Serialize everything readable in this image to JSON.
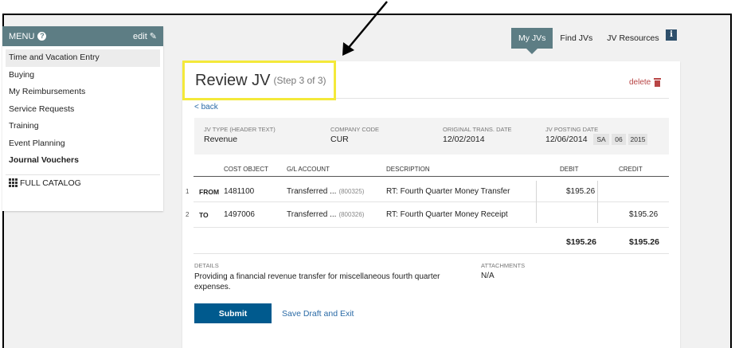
{
  "sidebar": {
    "title": "MENU",
    "edit_label": "edit",
    "items": [
      {
        "label": "Time and Vacation Entry"
      },
      {
        "label": "Buying"
      },
      {
        "label": "My Reimbursements"
      },
      {
        "label": "Service Requests"
      },
      {
        "label": "Training"
      },
      {
        "label": "Event Planning"
      },
      {
        "label": "Journal Vouchers"
      }
    ],
    "catalog_label": "FULL CATALOG"
  },
  "tabs": [
    {
      "label": "My JVs",
      "active": true
    },
    {
      "label": "Find JVs"
    },
    {
      "label": "JV Resources"
    }
  ],
  "info_icon_glyph": "i",
  "page": {
    "title": "Review JV",
    "step": "(Step 3 of 3)",
    "delete_label": "delete",
    "back_label": "< back"
  },
  "header_info": {
    "jv_type_label": "JV TYPE (HEADER TEXT)",
    "jv_type_value": "Revenue",
    "company_code_label": "COMPANY CODE",
    "company_code_value": "CUR",
    "orig_date_label": "ORIGINAL TRANS. DATE",
    "orig_date_value": "12/02/2014",
    "posting_date_label": "JV POSTING DATE",
    "posting_date_value": "12/06/2014",
    "posting_parts": [
      "SA",
      "06",
      "2015"
    ]
  },
  "table": {
    "headers": [
      "COST OBJECT",
      "G/L ACCOUNT",
      "DESCRIPTION",
      "DEBIT",
      "CREDIT"
    ],
    "rows": [
      {
        "num": "1",
        "direction": "FROM",
        "cost_object": "1481100",
        "gl_account": "Transferred ...",
        "gl_code": "(800325)",
        "description": "RT: Fourth Quarter Money Transfer",
        "debit": "$195.26",
        "credit": ""
      },
      {
        "num": "2",
        "direction": "TO",
        "cost_object": "1497006",
        "gl_account": "Transferred ...",
        "gl_code": "(800326)",
        "description": "RT: Fourth Quarter Money Receipt",
        "debit": "",
        "credit": "$195.26"
      }
    ],
    "total_debit": "$195.26",
    "total_credit": "$195.26"
  },
  "details": {
    "label": "DETAILS",
    "text": "Providing a financial revenue transfer for miscellaneous fourth quarter expenses.",
    "attachments_label": "ATTACHMENTS",
    "attachments_value": "N/A"
  },
  "actions": {
    "submit_label": "Submit",
    "save_label": "Save Draft and Exit"
  },
  "colors": {
    "menu_header": "#5d7d84",
    "highlight_box": "#f4e93a",
    "primary_button": "#005a8e",
    "link": "#2a6aa6",
    "delete": "#b84545"
  }
}
